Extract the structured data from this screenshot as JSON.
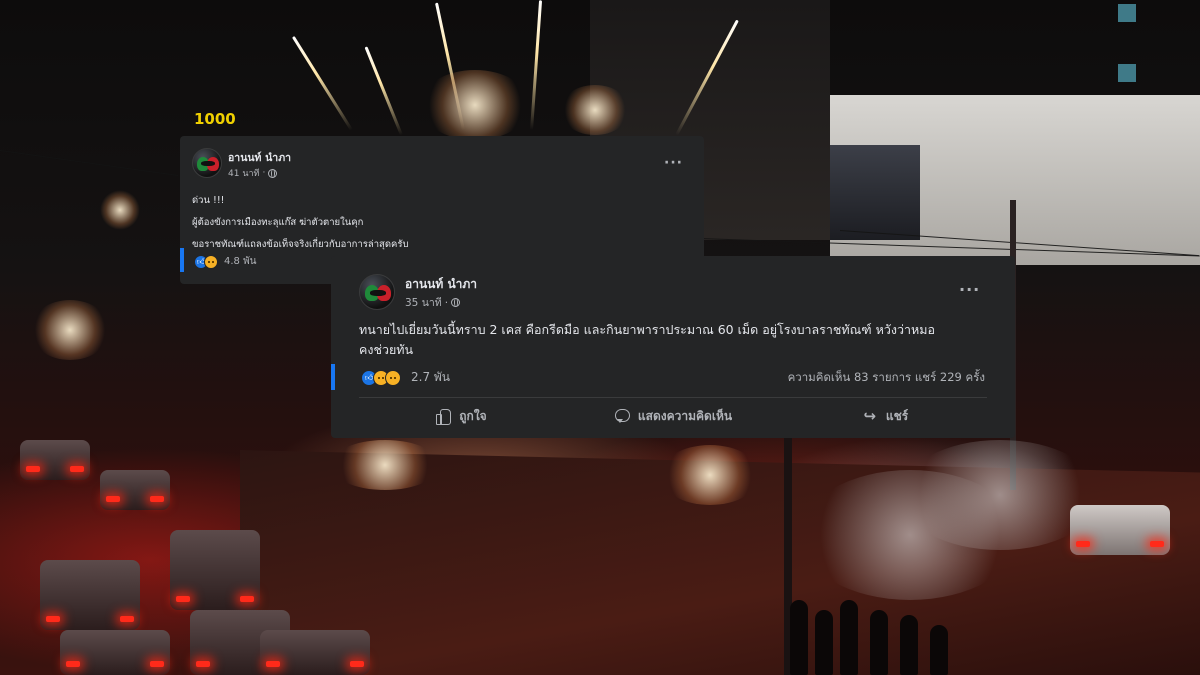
{
  "background": {
    "description_colors": {
      "accent_red": "#c8202a",
      "sign_text_color": "#f0d000"
    },
    "sign_text": "1000"
  },
  "post_back": {
    "author": "อานนท์ นำภา",
    "time": "41 นาที",
    "lines": [
      "ด่วน !!!",
      "ผู้ต้องขังการเมืองทะลุแก๊ส ฆ่าตัวตายในคุก",
      "ขอราชทัณฑ์แถลงข้อเท็จจริงเกี่ยวกับอาการล่าสุดครับ"
    ],
    "reaction_count": "4.8 พัน",
    "reactions": [
      "like-icon",
      "sad-icon"
    ]
  },
  "post_front": {
    "author": "อานนท์ นำภา",
    "time": "35 นาที",
    "text_line_1": "ทนายไปเยี่ยมวันนี้ทราบ 2 เคส คือกรีดมือ และกินยาพาราประมาณ 60 เม็ด อยู่โรงบาลราชทัณฑ์ หวังว่าหมอ",
    "text_line_2": "คงช่วยทัน",
    "reaction_count": "2.7 พัน",
    "reactions": [
      "like-icon",
      "care-icon",
      "sad-icon"
    ],
    "stats": "ความคิดเห็น 83 รายการ  แชร์ 229 ครั้ง",
    "actions": {
      "like": "ถูกใจ",
      "comment": "แสดงความคิดเห็น",
      "share": "แชร์"
    },
    "accent_color": "#1877f2"
  }
}
